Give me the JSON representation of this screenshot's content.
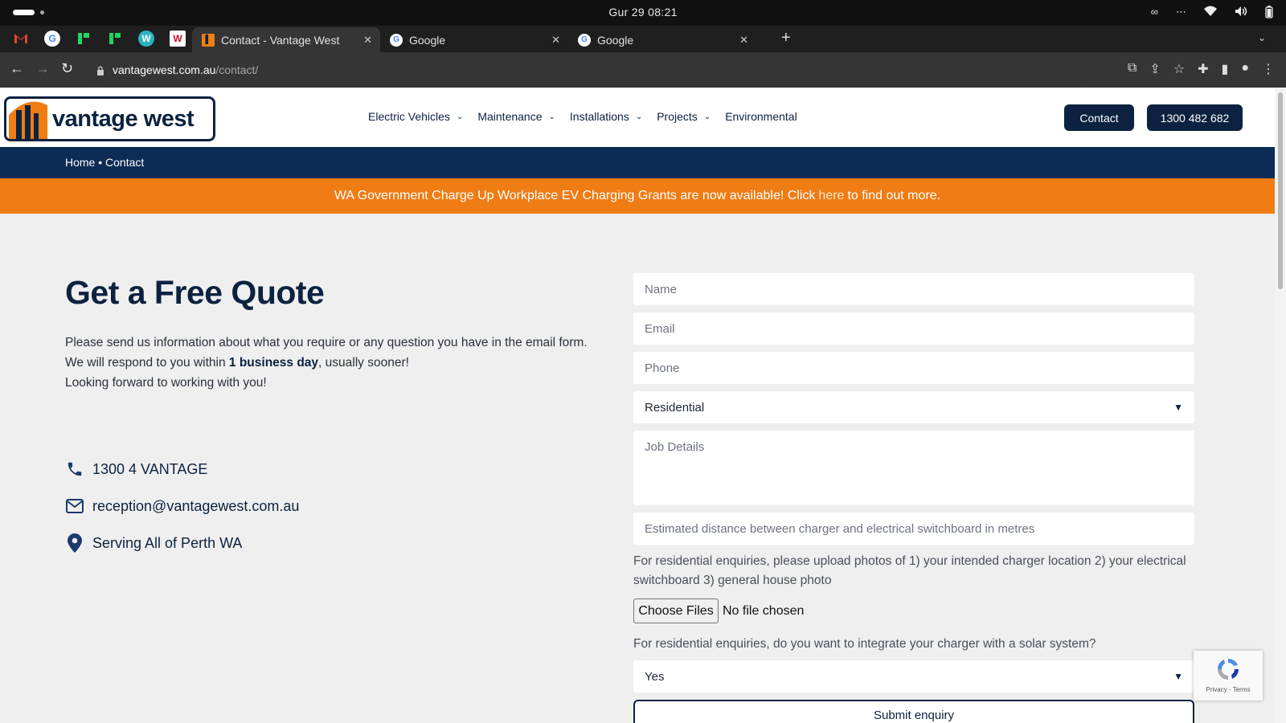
{
  "os": {
    "clock": "Gur 29  08:21"
  },
  "tabs": [
    {
      "title": "Contact - Vantage West",
      "active": true
    },
    {
      "title": "Google",
      "active": false
    },
    {
      "title": "Google",
      "active": false
    }
  ],
  "address": {
    "host": "vantagewest.com.au",
    "path": "/contact/"
  },
  "site": {
    "logo_text": "vantage west",
    "nav": [
      "Electric Vehicles",
      "Maintenance",
      "Installations",
      "Projects",
      "Environmental"
    ],
    "contact_button": "Contact",
    "phone_button": "1300 482 682",
    "breadcrumb": "Home • Contact",
    "promo_before": "WA Government Charge Up Workplace EV Charging Grants are now available! Click",
    "promo_link": "here",
    "promo_after": "to find out more."
  },
  "intro": {
    "heading": "Get a Free Quote",
    "line1": "Please send us information about what you require or any question you have in the email form.",
    "line2_before": "We will respond to you within ",
    "line2_bold": "1 business day",
    "line2_after": ", usually sooner!",
    "line3": "Looking forward to working with you!"
  },
  "contact_info": {
    "phone": "1300 4 VANTAGE",
    "email": "reception@vantagewest.com.au",
    "location": "Serving All of Perth WA"
  },
  "form": {
    "name_placeholder": "Name",
    "email_placeholder": "Email",
    "phone_placeholder": "Phone",
    "type_selected": "Residential",
    "details_placeholder": "Job Details",
    "distance_placeholder": "Estimated distance between charger and electrical switchboard in metres",
    "upload_help": "For residential enquiries, please upload photos of 1) your intended charger location 2) your electrical switchboard 3) general house photo",
    "file_button": "Choose Files",
    "file_status": "No file chosen",
    "solar_help": "For residential enquiries, do you want to integrate your charger with a solar system?",
    "solar_selected": "Yes",
    "submit": "Submit enquiry"
  },
  "recaptcha": {
    "text": "Privacy - Terms"
  },
  "colors": {
    "navy": "#0c2240",
    "crumb_bar": "#0c2b55",
    "orange": "#f07c14"
  }
}
